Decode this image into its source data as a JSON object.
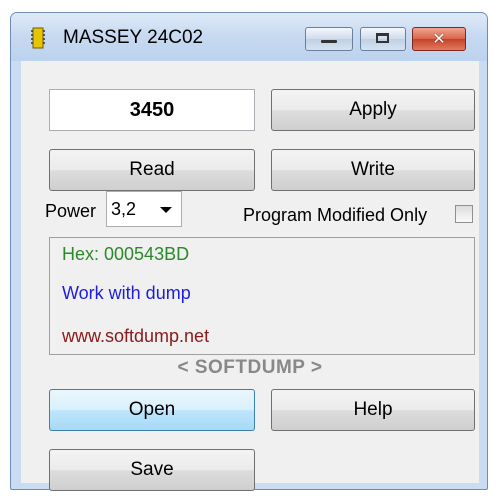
{
  "window": {
    "title": "MASSEY 24C02",
    "close_glyph": "✕"
  },
  "main": {
    "value": "3450",
    "apply_label": "Apply",
    "read_label": "Read",
    "write_label": "Write",
    "power_label": "Power",
    "power_value": "3,2",
    "program_modified_label": "Program Modified Only",
    "program_modified_checked": false,
    "info": {
      "hex": "Hex: 000543BD",
      "work": "Work with dump",
      "site": "www.softdump.net"
    },
    "brand": "< SOFTDUMP >",
    "open_label": "Open",
    "help_label": "Help",
    "save_label": "Save"
  },
  "colors": {
    "hex_text": "#2a8a2a",
    "work_text": "#1e1edc",
    "site_text": "#8a1a1a"
  },
  "icons": [
    "chip-icon",
    "minimize-icon",
    "maximize-icon",
    "close-icon",
    "dropdown-arrow-icon"
  ]
}
